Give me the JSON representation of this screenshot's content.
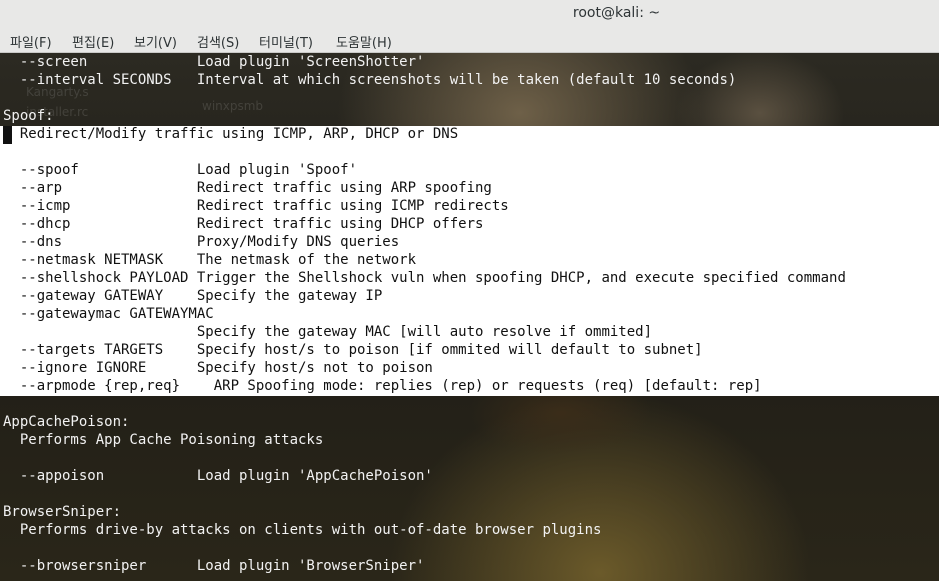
{
  "window": {
    "title": "root@kali: ~"
  },
  "menu": [
    "파일(F)",
    "편집(E)",
    "보기(V)",
    "검색(S)",
    "터미널(T)",
    "도움말(H)"
  ],
  "background_ghost_text": [
    "Kangarty.s",
    "installer.rc",
    "winxpsmb"
  ],
  "terminal_lines": [
    "  --screen             Load plugin 'ScreenShotter'",
    "  --interval SECONDS   Interval at which screenshots will be taken (default 10 seconds)",
    "",
    "Spoof:",
    "  Redirect/Modify traffic using ICMP, ARP, DHCP or DNS",
    "",
    "  --spoof              Load plugin 'Spoof'",
    "  --arp                Redirect traffic using ARP spoofing",
    "  --icmp               Redirect traffic using ICMP redirects",
    "  --dhcp               Redirect traffic using DHCP offers",
    "  --dns                Proxy/Modify DNS queries",
    "  --netmask NETMASK    The netmask of the network",
    "  --shellshock PAYLOAD Trigger the Shellshock vuln when spoofing DHCP, and execute specified command",
    "  --gateway GATEWAY    Specify the gateway IP",
    "  --gatewaymac GATEWAYMAC",
    "                       Specify the gateway MAC [will auto resolve if ommited]",
    "  --targets TARGETS    Specify host/s to poison [if ommited will default to subnet]",
    "  --ignore IGNORE      Specify host/s not to poison",
    "  --arpmode {rep,req}    ARP Spoofing mode: replies (rep) or requests (req) [default: rep]",
    "",
    "AppCachePoison:",
    "  Performs App Cache Poisoning attacks",
    "",
    "  --appoison           Load plugin 'AppCachePoison'",
    "",
    "BrowserSniper:",
    "  Performs drive-by attacks on clients with out-of-date browser plugins",
    "",
    "  --browsersniper      Load plugin 'BrowserSniper'"
  ]
}
